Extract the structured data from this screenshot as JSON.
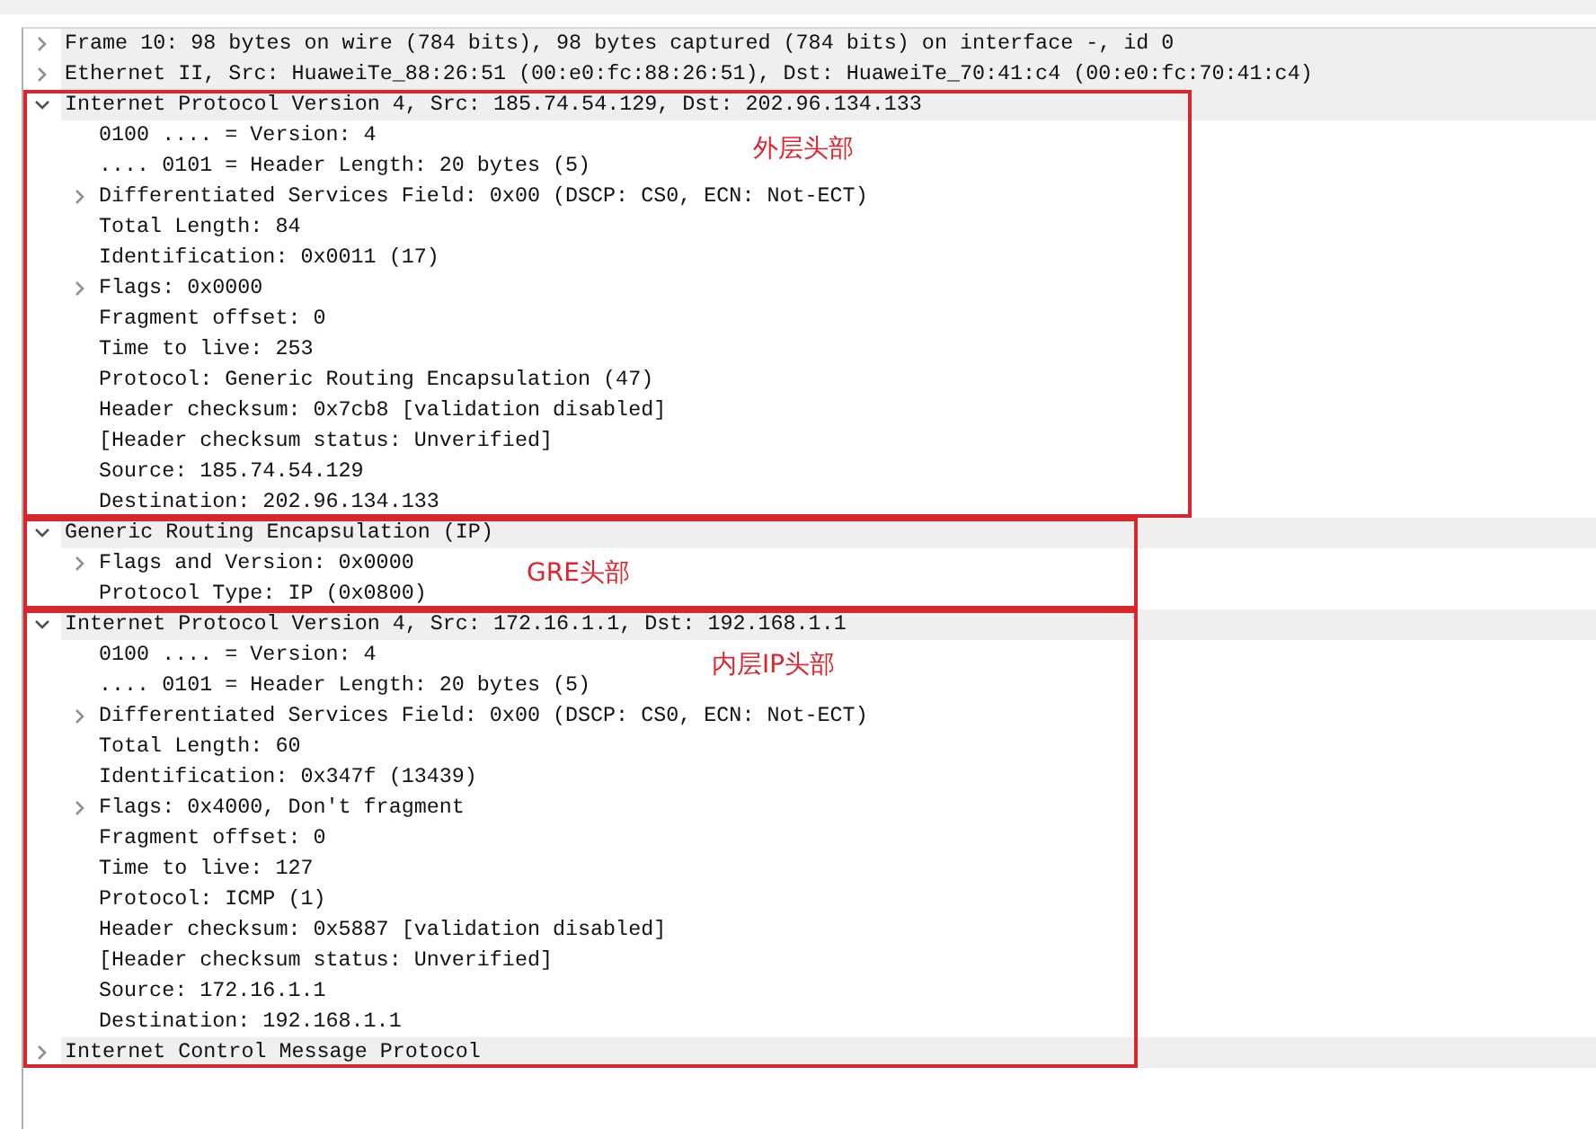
{
  "sections": [
    {
      "nodes": [
        {
          "label": "Frame 10: 98 bytes on wire (784 bits), 98 bytes captured (784 bits) on interface -, id 0",
          "expanded": false
        },
        {
          "label": "Ethernet II, Src: HuaweiTe_88:26:51 (00:e0:fc:88:26:51), Dst: HuaweiTe_70:41:c4 (00:e0:fc:70:41:c4)",
          "expanded": false
        }
      ]
    },
    {
      "note": "外层头部",
      "nodes": [
        {
          "label": "Internet Protocol Version 4, Src: 185.74.54.129, Dst: 202.96.134.133",
          "expanded": true,
          "children": [
            {
              "label": "0100 .... = Version: 4",
              "expandable": false
            },
            {
              "label": ".... 0101 = Header Length: 20 bytes (5)",
              "expandable": false
            },
            {
              "label": "Differentiated Services Field: 0x00 (DSCP: CS0, ECN: Not-ECT)",
              "expandable": true
            },
            {
              "label": "Total Length: 84",
              "expandable": false
            },
            {
              "label": "Identification: 0x0011 (17)",
              "expandable": false
            },
            {
              "label": "Flags: 0x0000",
              "expandable": true
            },
            {
              "label": "Fragment offset: 0",
              "expandable": false
            },
            {
              "label": "Time to live: 253",
              "expandable": false
            },
            {
              "label": "Protocol: Generic Routing Encapsulation (47)",
              "expandable": false
            },
            {
              "label": "Header checksum: 0x7cb8 [validation disabled]",
              "expandable": false
            },
            {
              "label": "[Header checksum status: Unverified]",
              "expandable": false
            },
            {
              "label": "Source: 185.74.54.129",
              "expandable": false
            },
            {
              "label": "Destination: 202.96.134.133",
              "expandable": false
            }
          ]
        }
      ]
    },
    {
      "note": "GRE头部",
      "nodes": [
        {
          "label": "Generic Routing Encapsulation (IP)",
          "expanded": true,
          "children": [
            {
              "label": "Flags and Version: 0x0000",
              "expandable": true
            },
            {
              "label": "Protocol Type: IP (0x0800)",
              "expandable": false
            }
          ]
        }
      ]
    },
    {
      "note": "内层IP头部",
      "nodes": [
        {
          "label": "Internet Protocol Version 4, Src: 172.16.1.1, Dst: 192.168.1.1",
          "expanded": true,
          "children": [
            {
              "label": "0100 .... = Version: 4",
              "expandable": false
            },
            {
              "label": ".... 0101 = Header Length: 20 bytes (5)",
              "expandable": false
            },
            {
              "label": "Differentiated Services Field: 0x00 (DSCP: CS0, ECN: Not-ECT)",
              "expandable": true
            },
            {
              "label": "Total Length: 60",
              "expandable": false
            },
            {
              "label": "Identification: 0x347f (13439)",
              "expandable": false
            },
            {
              "label": "Flags: 0x4000, Don't fragment",
              "expandable": true
            },
            {
              "label": "Fragment offset: 0",
              "expandable": false
            },
            {
              "label": "Time to live: 127",
              "expandable": false
            },
            {
              "label": "Protocol: ICMP (1)",
              "expandable": false
            },
            {
              "label": "Header checksum: 0x5887 [validation disabled]",
              "expandable": false
            },
            {
              "label": "[Header checksum status: Unverified]",
              "expandable": false
            },
            {
              "label": "Source: 172.16.1.1",
              "expandable": false
            },
            {
              "label": "Destination: 192.168.1.1",
              "expandable": false
            }
          ]
        },
        {
          "label": "Internet Control Message Protocol",
          "expanded": false
        }
      ]
    }
  ]
}
